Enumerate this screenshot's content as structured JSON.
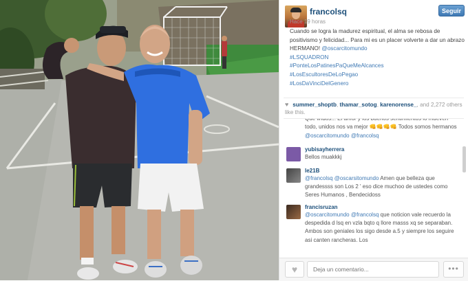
{
  "post": {
    "username": "francolsq",
    "follow_label": "Seguir",
    "time": "Hace 19 horas",
    "caption_text": "Cuando se logra la madurez espiritual, el alma se rebosa de positivismo y felicidad... Para mi es un placer volverte a dar un abrazo HERMANO!",
    "caption_mention": "@oscarcitomundo",
    "hashtags": [
      "#LSQUADRON",
      "#PonteLosPatinesPaQueMeAlcances",
      "#LosEscultoresDeLoPegao",
      "#LosDaVinciDelGenero"
    ]
  },
  "likes": {
    "users": [
      "summer_shoptb",
      "thamar_sotog",
      "karenorense_"
    ],
    "and_word": "and",
    "count": "2,272",
    "suffix": "others like this."
  },
  "comments": [
    {
      "username": "",
      "text": "Que lindos... El amor y los buenos sentimientos lo mueven todo, unidos nos va mejor 👊👊👊👊 Todos somos hermanos",
      "mentions": "@oscarcitomundo @francolsq",
      "avatar_color": "#c9c9c9"
    },
    {
      "username": "yubisayherrera",
      "text": "Bellos muakkkj",
      "mentions": "",
      "avatar_color": "#7b5aa6"
    },
    {
      "username": "le21B",
      "pre": "",
      "mentions": "@francolsq @oscarsitomundo",
      "text": "Amen  que belleza que grandessss son Los 2 ' eso dice muchoo de ustedes como Seres Humanos , Bendecidoss",
      "avatar_color": "#555555"
    },
    {
      "username": "francisruzan",
      "mentions": "@oscarcitomundo @francolsq",
      "text": "que noticion vale recuerdo la despedida d lsq en vzla bqto q llore masss xq se separaban. Ambos son geniales los sigo desde a.5 y siempre los seguire asi canten rancheras. Los",
      "avatar_color": "#6e4a2e"
    }
  ],
  "footer": {
    "comment_placeholder": "Deja un comentario...",
    "more_label": "•••"
  },
  "icons": {
    "like": "heart-icon",
    "more": "ellipsis-icon"
  },
  "colors": {
    "link": "#3f79b4",
    "username": "#1c4f7a",
    "follow_button": "#4f8ac4"
  }
}
